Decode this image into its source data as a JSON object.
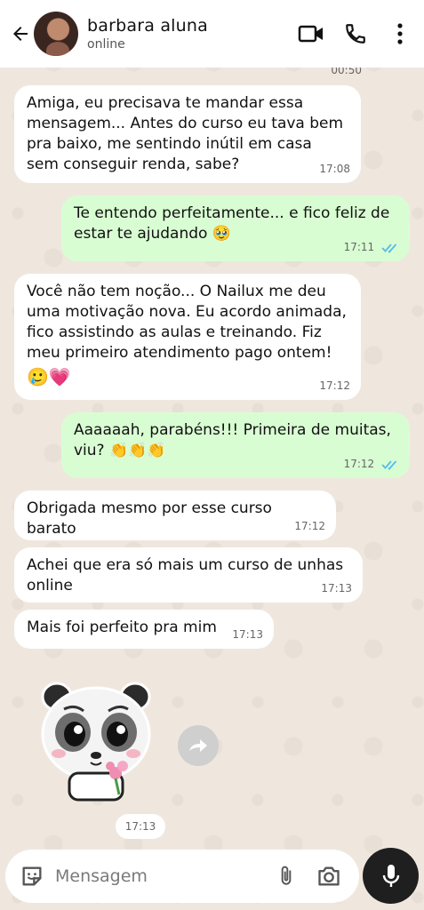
{
  "header": {
    "contact_name": "barbara aluna",
    "status": "online"
  },
  "partial_time": "00:50",
  "messages": [
    {
      "dir": "in",
      "text": "Amiga, eu precisava te mandar essa mensagem... Antes do curso eu tava bem pra baixo, me sentindo inútil em casa sem conseguir renda, sabe?",
      "time": "17:08"
    },
    {
      "dir": "out",
      "text": "Te entendo perfeitamente... e fico feliz de estar te ajudando 🥹",
      "time": "17:11"
    },
    {
      "dir": "in",
      "text": "Você não tem noção... O Nailux me deu uma motivação nova. Eu acordo animada, fico assistindo as aulas e treinando. Fiz meu primeiro atendimento pago ontem!",
      "emoji": "🥲💗",
      "time": "17:12"
    },
    {
      "dir": "out",
      "text": "Aaaaaah, parabéns!!! Primeira de muitas, viu? 👏👏👏",
      "time": "17:12"
    },
    {
      "dir": "in",
      "text": "Obrigada mesmo por esse curso barato",
      "time": "17:12"
    },
    {
      "dir": "in",
      "text": "Achei que era só  mais um curso de unhas online",
      "time": "17:13"
    },
    {
      "dir": "in",
      "text": "Mais foi perfeito pra mim",
      "time": "17:13"
    }
  ],
  "sticker": {
    "time": "17:13"
  },
  "input": {
    "placeholder": "Mensagem"
  },
  "colors": {
    "outgoing": "#d9fdd3",
    "incoming": "#ffffff",
    "read_ticks": "#53bdeb",
    "background": "#efe7de"
  }
}
